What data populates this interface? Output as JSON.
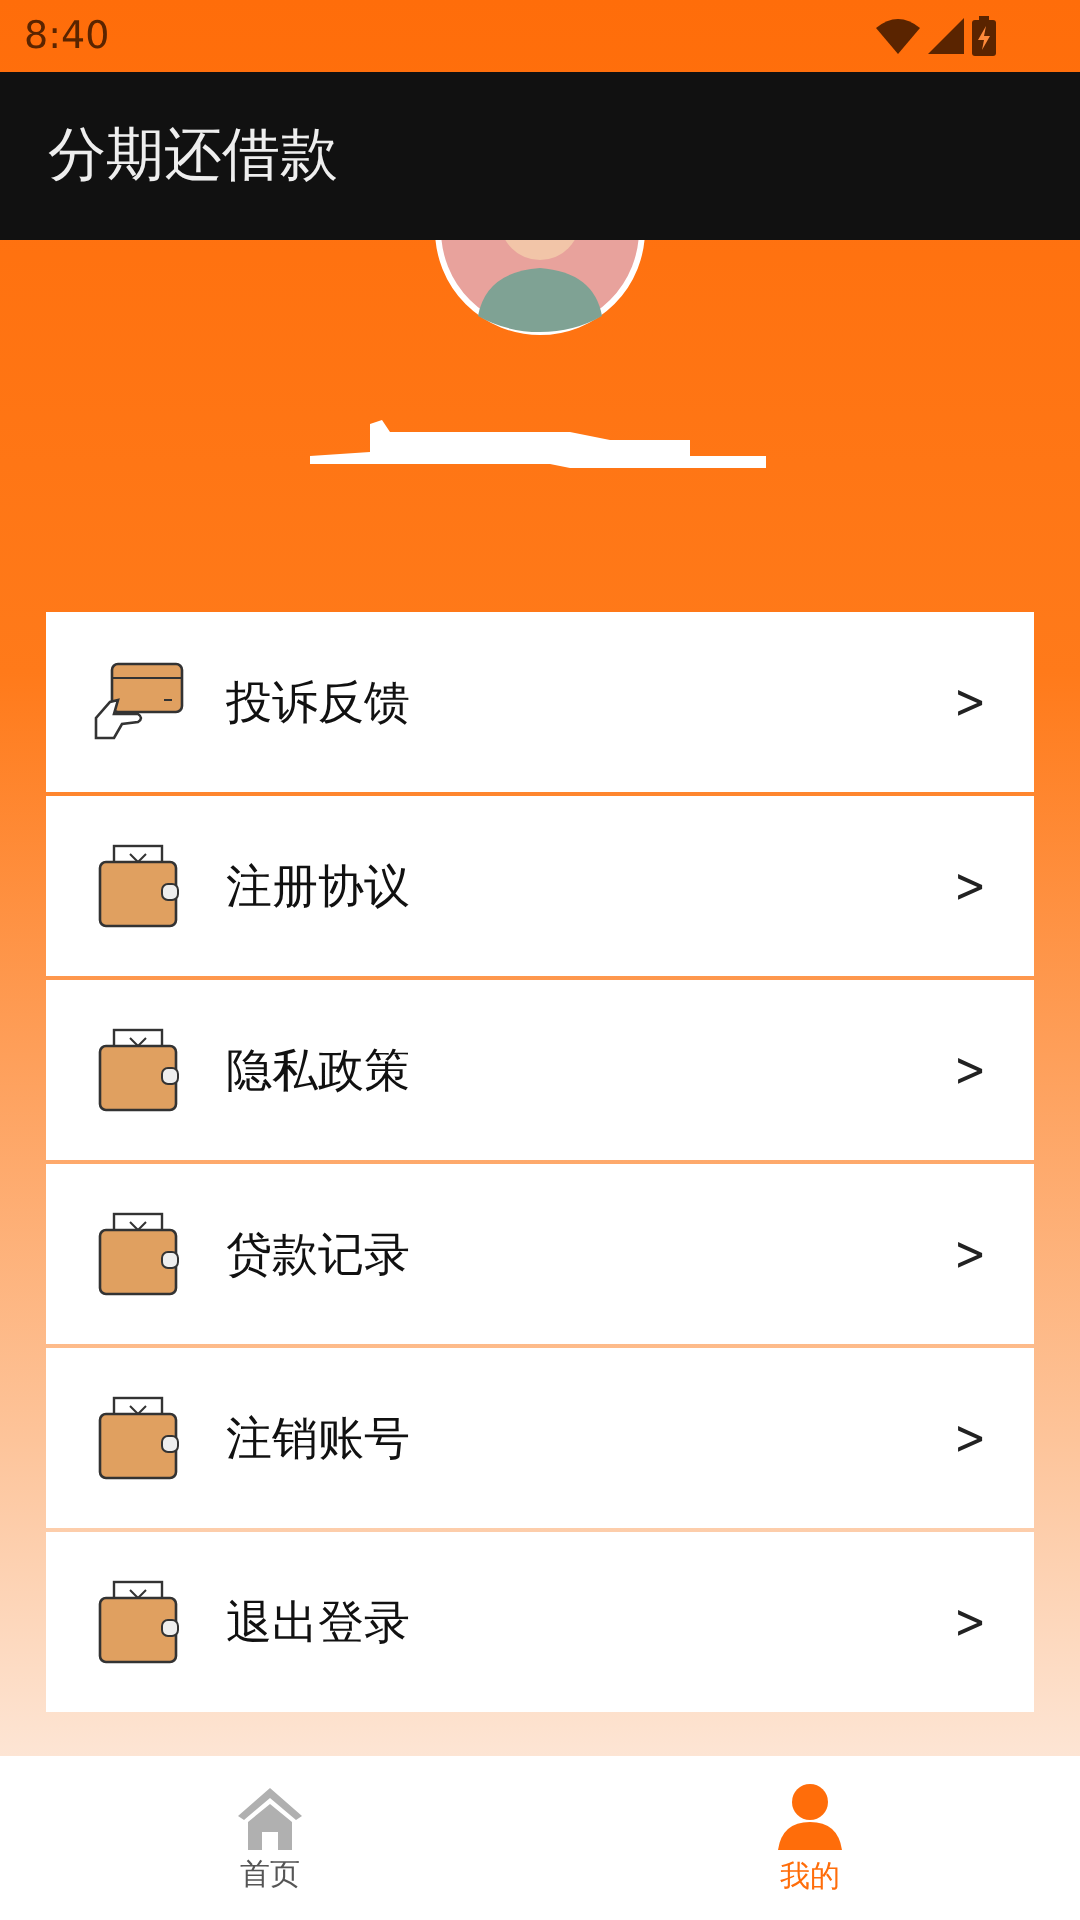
{
  "status_bar": {
    "time": "8:40"
  },
  "app_bar": {
    "title": "分期还借款"
  },
  "menu": [
    {
      "kind": "card",
      "label": "投诉反馈",
      "chevron": ">"
    },
    {
      "kind": "wallet",
      "label": "注册协议",
      "chevron": ">"
    },
    {
      "kind": "wallet",
      "label": "隐私政策",
      "chevron": ">"
    },
    {
      "kind": "wallet",
      "label": "贷款记录",
      "chevron": ">"
    },
    {
      "kind": "wallet",
      "label": "注销账号",
      "chevron": ">"
    },
    {
      "kind": "wallet",
      "label": "退出登录",
      "chevron": ">"
    }
  ],
  "tabs": [
    {
      "kind": "home",
      "label": "首页",
      "selected": false
    },
    {
      "kind": "person",
      "label": "我的",
      "selected": true
    }
  ]
}
